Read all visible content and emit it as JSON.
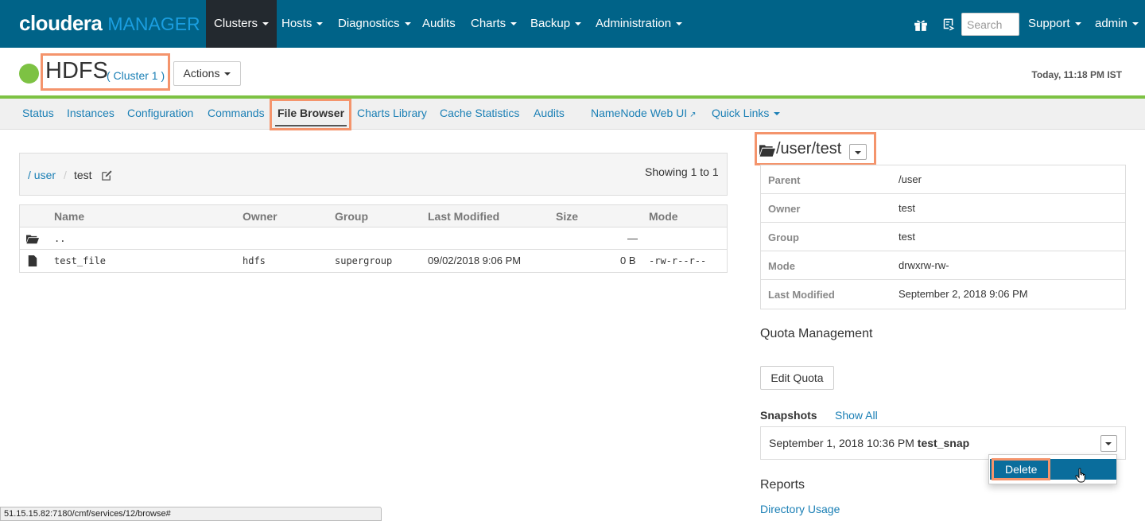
{
  "navbar": {
    "brand_primary": "cloudera",
    "brand_secondary": "MANAGER",
    "items": [
      {
        "label": "Clusters",
        "dropdown": true,
        "active": true
      },
      {
        "label": "Hosts",
        "dropdown": true
      },
      {
        "label": "Diagnostics",
        "dropdown": true
      },
      {
        "label": "Audits",
        "dropdown": false
      },
      {
        "label": "Charts",
        "dropdown": true
      },
      {
        "label": "Backup",
        "dropdown": true
      },
      {
        "label": "Administration",
        "dropdown": true
      }
    ],
    "icons": [
      "gift-icon",
      "release-notes-icon"
    ],
    "search_placeholder": "Search",
    "support_label": "Support",
    "user_label": "admin"
  },
  "service": {
    "name": "HDFS",
    "cluster": "( Cluster 1 )",
    "status_color": "#7dc243",
    "actions_label": "Actions",
    "timestamp": "Today, 11:18 PM IST"
  },
  "tabs": [
    {
      "label": "Status"
    },
    {
      "label": "Instances"
    },
    {
      "label": "Configuration"
    },
    {
      "label": "Commands"
    },
    {
      "label": "File Browser",
      "active": true
    },
    {
      "label": "Charts Library"
    },
    {
      "label": "Cache Statistics"
    },
    {
      "label": "Audits"
    },
    {
      "label": "NameNode Web UI",
      "external": true
    },
    {
      "label": "Quick Links",
      "dropdown": true
    }
  ],
  "browser": {
    "breadcrumb": [
      {
        "label": "/ user",
        "link": true
      },
      {
        "label": "/",
        "separator": true
      },
      {
        "label": "test",
        "link": false
      }
    ],
    "showing": "Showing 1 to 1",
    "columns": [
      "Name",
      "Owner",
      "Group",
      "Last Modified",
      "Size",
      "Mode"
    ],
    "rows": [
      {
        "icon": "folder-icon",
        "name": "..",
        "owner": "",
        "group": "",
        "modified": "",
        "size": "—",
        "mode": ""
      },
      {
        "icon": "file-icon",
        "name": "test_file",
        "owner": "hdfs",
        "group": "supergroup",
        "modified": "09/02/2018 9:06 PM",
        "size": "0 B",
        "mode": "-rw-r--r--"
      }
    ]
  },
  "details": {
    "path": "/user/test",
    "fields": [
      {
        "label": "Parent",
        "value": "/user"
      },
      {
        "label": "Owner",
        "value": "test"
      },
      {
        "label": "Group",
        "value": "test"
      },
      {
        "label": "Mode",
        "value": "drwxrw-rw-"
      },
      {
        "label": "Last Modified",
        "value": "September 2, 2018 9:06 PM"
      }
    ],
    "quota_title": "Quota Management",
    "edit_quota_label": "Edit Quota",
    "snapshots_label": "Snapshots",
    "show_all_label": "Show All",
    "snapshot": {
      "date": "September 1, 2018 10:36 PM",
      "name": "test_snap"
    },
    "snapshot_menu": [
      "Delete"
    ],
    "reports_title": "Reports",
    "directory_usage_label": "Directory Usage"
  },
  "statusbar": {
    "url": "51.15.15.82:7180/cmf/services/12/browse#"
  },
  "colors": {
    "navbar": "#006388",
    "accent_link": "#1a7fb5",
    "status_green": "#7dc243",
    "highlight": "#f4946c"
  }
}
